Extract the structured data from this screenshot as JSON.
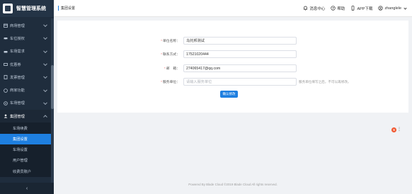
{
  "app": {
    "title": "智慧管理系统"
  },
  "sidebar": {
    "items": [
      {
        "label": "商场管理",
        "icon": "shop-icon"
      },
      {
        "label": "车位授权",
        "icon": "car-icon"
      },
      {
        "label": "车场需求",
        "icon": "car-request-icon"
      },
      {
        "label": "优惠券",
        "icon": "coupon-icon"
      },
      {
        "label": "发票管理",
        "icon": "invoice-icon"
      },
      {
        "label": "商家功能",
        "icon": "merchant-icon"
      },
      {
        "label": "车场管理",
        "icon": "parking-icon"
      }
    ],
    "open_group": {
      "label": "集团管理",
      "icon": "group-icon",
      "children": [
        {
          "label": "车场续费"
        },
        {
          "label": "集团设置"
        },
        {
          "label": "车场设置"
        },
        {
          "label": "用户管理"
        },
        {
          "label": "收费员账户"
        }
      ]
    },
    "collapse_symbol": "‹"
  },
  "header": {
    "breadcrumb": "集团设置",
    "actions": {
      "messages": "消息中心",
      "help": "帮助",
      "app_download": "APP下载",
      "user": "zhanglele"
    }
  },
  "form": {
    "unit_name": {
      "label": "单位名称：",
      "value": "乌托邦测试"
    },
    "contact": {
      "label": "联系方式：",
      "value": "17521020444"
    },
    "email": {
      "label": "邮　箱：",
      "value": "274065417@qq.com"
    },
    "service_unit": {
      "label": "服务单位：",
      "placeholder": "请输入服务单位",
      "hint": "服务单位填写之后，不可以再修改。"
    },
    "submit_label": "确认修改"
  },
  "float_widget": {
    "icon": "sogou-input-icon",
    "glyph": "S",
    "more": "⋮"
  },
  "footer": {
    "text": "Powered By Blade Cloud ©2019 Blade Cloud All rights reserved."
  },
  "colors": {
    "sidebar_bg": "#1f2d3d",
    "accent": "#1e7fe0",
    "required": "#f56c6c"
  }
}
